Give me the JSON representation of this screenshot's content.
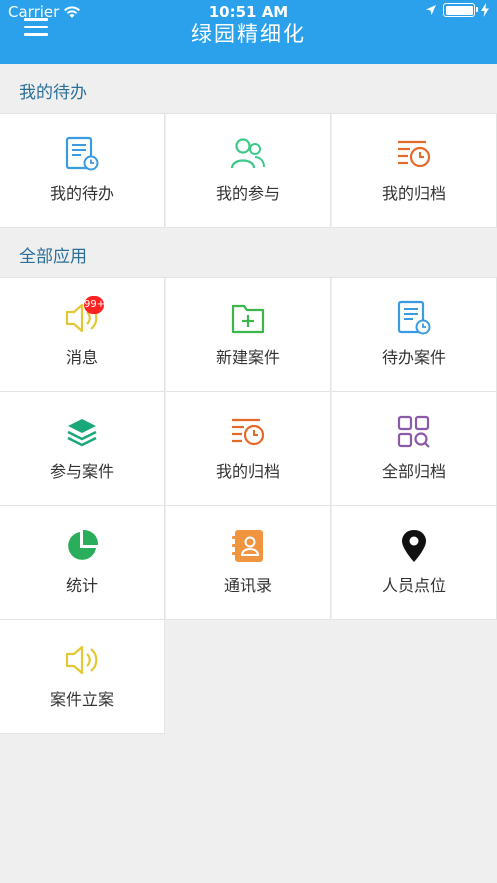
{
  "status_bar": {
    "carrier": "Carrier",
    "time": "10:51 AM"
  },
  "header": {
    "title": "绿园精细化"
  },
  "sections": [
    {
      "label": "我的待办",
      "items": [
        {
          "label": "我的待办",
          "icon": "doc-clock-icon"
        },
        {
          "label": "我的参与",
          "icon": "users-icon"
        },
        {
          "label": "我的归档",
          "icon": "list-clock-icon"
        }
      ]
    },
    {
      "label": "全部应用",
      "items": [
        {
          "label": "消息",
          "icon": "speaker-icon",
          "badge": "99+"
        },
        {
          "label": "新建案件",
          "icon": "folder-plus-icon"
        },
        {
          "label": "待办案件",
          "icon": "doc-clock-icon"
        },
        {
          "label": "参与案件",
          "icon": "layers-icon"
        },
        {
          "label": "我的归档",
          "icon": "list-clock-icon"
        },
        {
          "label": "全部归档",
          "icon": "grid-search-icon"
        },
        {
          "label": "统计",
          "icon": "pie-chart-icon"
        },
        {
          "label": "通讯录",
          "icon": "contacts-book-icon"
        },
        {
          "label": "人员点位",
          "icon": "location-pin-icon"
        },
        {
          "label": "案件立案",
          "icon": "speaker-icon"
        }
      ]
    }
  ],
  "colors": {
    "header": "#2aa1ea",
    "section_label": "#2a6f97",
    "blue_icon": "#3b9be0",
    "green_icon": "#3cc98a",
    "orange_icon": "#e46a2a",
    "yellow_icon": "#e2c832",
    "teal_icon": "#1aa87a",
    "purple_icon": "#8a5aa8",
    "stat_green": "#2bae5c",
    "contacts_orange": "#f09440"
  }
}
